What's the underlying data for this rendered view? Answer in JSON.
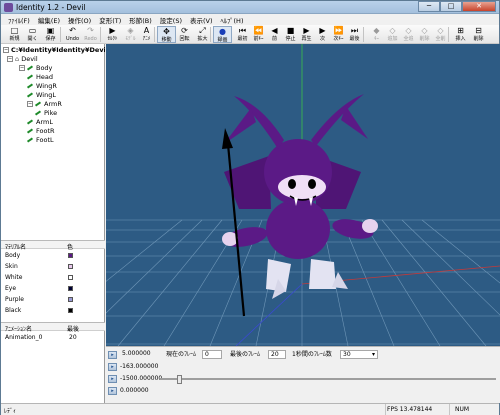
{
  "window": {
    "title": "Identity 1.2 - Devil",
    "minimize_label": "─",
    "maximize_label": "□",
    "close_label": "✕"
  },
  "menu": [
    "ﾌｧｲﾙ(F)",
    "編集(E)",
    "操作(O)",
    "変形(T)",
    "形節(B)",
    "設定(S)",
    "表示(V)",
    "ﾍﾙﾌﾟ(H)"
  ],
  "toolbar": {
    "buttons": [
      {
        "id": "new",
        "label": "新規",
        "icon": "□",
        "enabled": true
      },
      {
        "id": "open",
        "label": "開く",
        "icon": "▭",
        "enabled": true
      },
      {
        "id": "save",
        "label": "保存",
        "icon": "▣",
        "enabled": true
      },
      {
        "id": "undo",
        "label": "Undo",
        "icon": "↶",
        "enabled": true
      },
      {
        "id": "redo",
        "label": "Redo",
        "icon": "↷",
        "enabled": false
      },
      {
        "id": "bone",
        "label": "ｾﾙｸﾄ",
        "icon": "▶",
        "enabled": true
      },
      {
        "id": "model",
        "label": "ﾓﾃﾞﾙ",
        "icon": "◈",
        "enabled": false
      },
      {
        "id": "anim",
        "label": "ｱﾆﾒ",
        "icon": "A",
        "enabled": true
      },
      {
        "id": "move",
        "label": "移動",
        "icon": "✥",
        "enabled": true,
        "pressed": true
      },
      {
        "id": "rotate",
        "label": "回転",
        "icon": "⟳",
        "enabled": true
      },
      {
        "id": "scale",
        "label": "拡大",
        "icon": "⤢",
        "enabled": true
      },
      {
        "id": "record",
        "label": "録画",
        "icon": "●",
        "enabled": true,
        "pressed": true
      },
      {
        "id": "first",
        "label": "最初",
        "icon": "⏮",
        "enabled": true
      },
      {
        "id": "prevkey",
        "label": "前ｷｰ",
        "icon": "⏪",
        "enabled": true
      },
      {
        "id": "prev",
        "label": "前",
        "icon": "◀",
        "enabled": true
      },
      {
        "id": "stop",
        "label": "停止",
        "icon": "■",
        "enabled": true
      },
      {
        "id": "play",
        "label": "再生",
        "icon": "▶",
        "enabled": true
      },
      {
        "id": "next",
        "label": "次",
        "icon": "▶",
        "enabled": true
      },
      {
        "id": "nextkey",
        "label": "次ｷｰ",
        "icon": "⏩",
        "enabled": true
      },
      {
        "id": "last",
        "label": "最後",
        "icon": "⏭",
        "enabled": true
      },
      {
        "id": "key",
        "label": "ｷｰ",
        "icon": "◆",
        "enabled": false
      },
      {
        "id": "addkey",
        "label": "追加",
        "icon": "◇",
        "enabled": false
      },
      {
        "id": "allkey",
        "label": "全追",
        "icon": "◇",
        "enabled": false
      },
      {
        "id": "delkey",
        "label": "削除",
        "icon": "◇",
        "enabled": false
      },
      {
        "id": "alldel",
        "label": "全削",
        "icon": "◇",
        "enabled": false
      },
      {
        "id": "insert",
        "label": "挿入",
        "icon": "⊞",
        "enabled": true
      },
      {
        "id": "remove",
        "label": "削除",
        "icon": "⊟",
        "enabled": true
      }
    ]
  },
  "tree": {
    "root_path": "C:¥Identity¥Identity¥Devil.i",
    "model": "Devil",
    "bones": [
      {
        "name": "Body",
        "level": 1,
        "expander": "−"
      },
      {
        "name": "Head",
        "level": 2
      },
      {
        "name": "WingR",
        "level": 2
      },
      {
        "name": "WingL",
        "level": 2
      },
      {
        "name": "ArmR",
        "level": 2,
        "expander": "−"
      },
      {
        "name": "Pike",
        "level": 3
      },
      {
        "name": "ArmL",
        "level": 2
      },
      {
        "name": "FootR",
        "level": 2
      },
      {
        "name": "FootL",
        "level": 2
      }
    ]
  },
  "materials": {
    "header_name": "ﾏﾃﾘｱﾙ名",
    "header_color": "色",
    "rows": [
      {
        "name": "Body",
        "color": "#5b1a86"
      },
      {
        "name": "Skin",
        "color": "#e8c8ec"
      },
      {
        "name": "White",
        "color": "#ffffff"
      },
      {
        "name": "Eye",
        "color": "#000033"
      },
      {
        "name": "Purple",
        "color": "#9b9bd6"
      },
      {
        "name": "Black",
        "color": "#000000"
      }
    ]
  },
  "animations": {
    "header_name": "ｱﾆﾒｰｼｮﾝ名",
    "header_last": "最後",
    "rows": [
      {
        "name": "Animation_0",
        "last": "20"
      }
    ]
  },
  "timeline": {
    "value1": "5.000000",
    "current_frame_label": "現在のﾌﾚｰﾑ",
    "current_frame": "0",
    "last_frame_label": "最後のﾌﾚｰﾑ",
    "last_frame": "20",
    "fps_label": "1秒間のﾌﾚｰﾑ数",
    "fps": "30",
    "value2": "-163.000000",
    "value3": "-1500.000000",
    "value4": "0.000000",
    "slider_fraction": 0.05
  },
  "status": {
    "left": "ﾚﾃﾞｨ",
    "fps": "FPS 13.478144",
    "num": "NUM"
  },
  "colors": {
    "viewport_bg": "#2d5b84",
    "grid": "#6f97b8",
    "body": "#5b1a86",
    "white": "#eeeeff"
  }
}
